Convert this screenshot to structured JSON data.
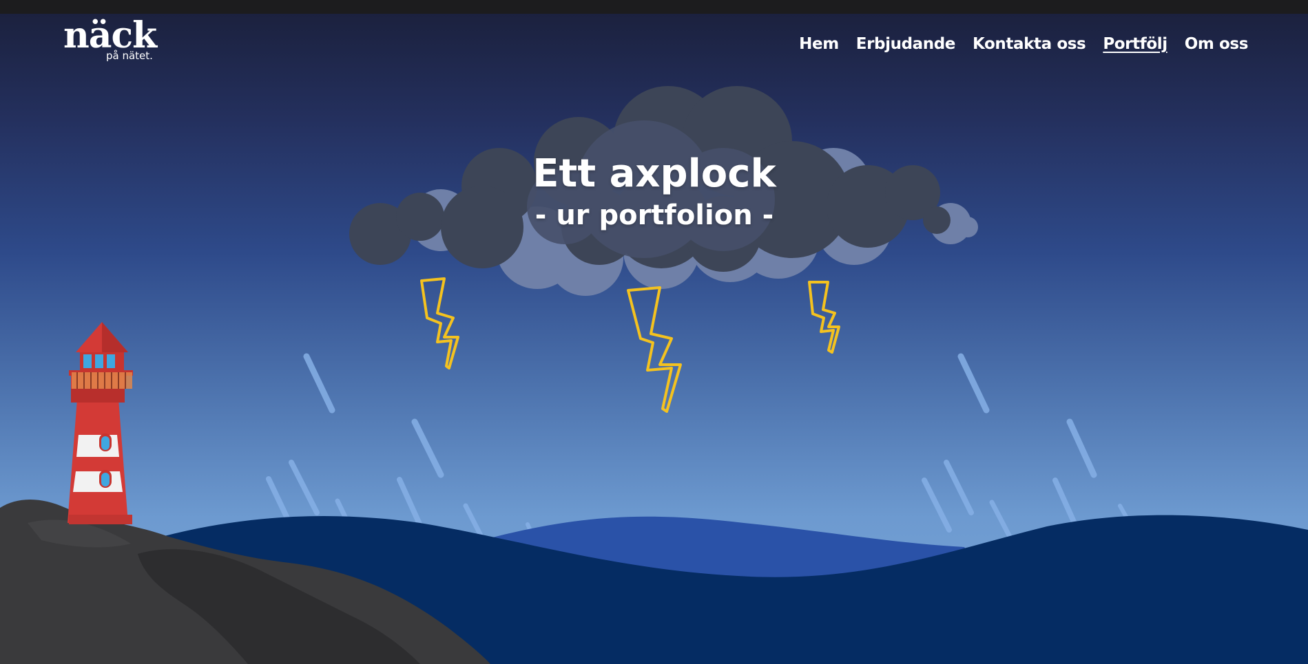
{
  "logo": {
    "main": "näck",
    "sub": "på nätet."
  },
  "nav": [
    {
      "label": "Hem",
      "active": false
    },
    {
      "label": "Erbjudande",
      "active": false
    },
    {
      "label": "Kontakta oss",
      "active": false
    },
    {
      "label": "Portfölj",
      "active": true
    },
    {
      "label": "Om oss",
      "active": false
    }
  ],
  "hero": {
    "title": "Ett axplock",
    "subtitle": "- ur portfolion -"
  },
  "colors": {
    "sky_top": "#1a1f3a",
    "sky_bottom": "#7aa6d8",
    "cloud": "#3d4557",
    "cloud_light": "#6f80a8",
    "lightning": "#f4c21f",
    "sea_front": "#052c63",
    "sea_back": "#2a52a8",
    "rock": "#3a3a3c",
    "lighthouse_red": "#d33a36",
    "lighthouse_white": "#f2f2f2",
    "topbar": "#1c1c1e"
  }
}
